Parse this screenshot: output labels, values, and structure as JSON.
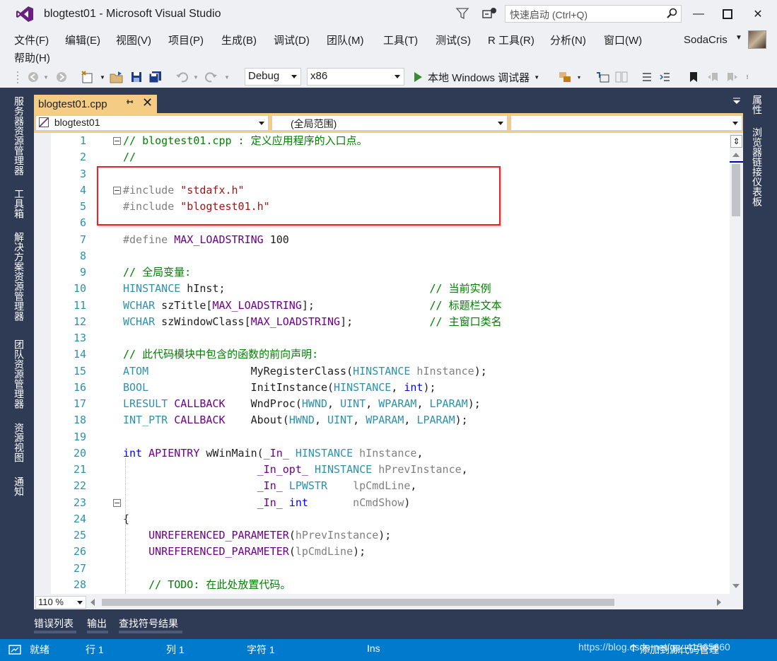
{
  "window": {
    "title": "blogtest01 - Microsoft Visual Studio",
    "quick_launch_placeholder": "快速启动 (Ctrl+Q)",
    "minimize": "—",
    "maximize": "□",
    "close": "✕"
  },
  "menu": {
    "items": [
      "文件(F)",
      "编辑(E)",
      "视图(V)",
      "项目(P)",
      "生成(B)",
      "调试(D)",
      "团队(M)",
      "工具(T)",
      "测试(S)",
      "R 工具(R)",
      "分析(N)",
      "窗口(W)"
    ],
    "help": "帮助(H)",
    "user": "SodaCris"
  },
  "toolbar": {
    "configuration": "Debug",
    "platform": "x86",
    "debugger_label": "本地 Windows 调试器"
  },
  "left_panel_tabs": [
    "服务器资源管理器",
    "工具箱",
    "解决方案资源管理器",
    "团队资源管理器",
    "资源视图",
    "通知"
  ],
  "right_panel_tabs": [
    "属性",
    "浏览器链接仪表板"
  ],
  "document": {
    "tab_label": "blogtest01.cpp",
    "pin_glyph": "⊞",
    "close_glyph": "✕"
  },
  "navbar": {
    "project": "blogtest01",
    "scope": "(全局范围)",
    "member": ""
  },
  "code_lines": [
    {
      "n": "1",
      "html": "<span class=\"c-cm\">// blogtest01.cpp : 定义应用程序的入口点。</span>"
    },
    {
      "n": "2",
      "html": "<span class=\"c-cm\">//</span>"
    },
    {
      "n": "3",
      "html": ""
    },
    {
      "n": "4",
      "html": "<span class=\"c-pp\">#include </span><span class=\"c-str\">\"stdafx.h\"</span>"
    },
    {
      "n": "5",
      "html": "<span class=\"c-pp\">#include </span><span class=\"c-str\">\"blogtest01.h\"</span>"
    },
    {
      "n": "6",
      "html": ""
    },
    {
      "n": "7",
      "html": "<span class=\"c-pp\">#define </span><span class=\"c-mac\">MAX_LOADSTRING</span> 100"
    },
    {
      "n": "8",
      "html": ""
    },
    {
      "n": "9",
      "html": "<span class=\"c-cm\">// 全局变量:</span>"
    },
    {
      "n": "10",
      "html": "<span class=\"c-ty\">HINSTANCE</span> hInst;                                <span class=\"c-cm\">// 当前实例</span>"
    },
    {
      "n": "11",
      "html": "<span class=\"c-ty\">WCHAR</span> szTitle[<span class=\"c-mac\">MAX_LOADSTRING</span>];                  <span class=\"c-cm\">// 标题栏文本</span>"
    },
    {
      "n": "12",
      "html": "<span class=\"c-ty\">WCHAR</span> szWindowClass[<span class=\"c-mac\">MAX_LOADSTRING</span>];            <span class=\"c-cm\">// 主窗口类名</span>"
    },
    {
      "n": "13",
      "html": ""
    },
    {
      "n": "14",
      "html": "<span class=\"c-cm\">// 此代码模块中包含的函数的前向声明:</span>"
    },
    {
      "n": "15",
      "html": "<span class=\"c-ty\">ATOM</span>                MyRegisterClass(<span class=\"c-ty\">HINSTANCE</span> <span class=\"c-par\">hInstance</span>);"
    },
    {
      "n": "16",
      "html": "<span class=\"c-ty\">BOOL</span>                InitInstance(<span class=\"c-ty\">HINSTANCE</span>, <span class=\"c-kw\">int</span>);"
    },
    {
      "n": "17",
      "html": "<span class=\"c-ty\">LRESULT</span> <span class=\"c-mac\">CALLBACK</span>    WndProc(<span class=\"c-ty\">HWND</span>, <span class=\"c-ty\">UINT</span>, <span class=\"c-ty\">WPARAM</span>, <span class=\"c-ty\">LPARAM</span>);"
    },
    {
      "n": "18",
      "html": "<span class=\"c-ty\">INT_PTR</span> <span class=\"c-mac\">CALLBACK</span>    About(<span class=\"c-ty\">HWND</span>, <span class=\"c-ty\">UINT</span>, <span class=\"c-ty\">WPARAM</span>, <span class=\"c-ty\">LPARAM</span>);"
    },
    {
      "n": "19",
      "html": ""
    },
    {
      "n": "20",
      "html": "<span class=\"c-kw\">int</span> <span class=\"c-mac\">APIENTRY</span> wWinMain(<span class=\"c-mac\">_In_</span> <span class=\"c-ty\">HINSTANCE</span> <span class=\"c-par\">hInstance</span>,"
    },
    {
      "n": "21",
      "html": "                     <span class=\"c-mac\">_In_opt_</span> <span class=\"c-ty\">HINSTANCE</span> <span class=\"c-par\">hPrevInstance</span>,"
    },
    {
      "n": "22",
      "html": "                     <span class=\"c-mac\">_In_</span> <span class=\"c-ty\">LPWSTR</span>    <span class=\"c-par\">lpCmdLine</span>,"
    },
    {
      "n": "23",
      "html": "                     <span class=\"c-mac\">_In_</span> <span class=\"c-kw\">int</span>       <span class=\"c-par\">nCmdShow</span>)"
    },
    {
      "n": "24",
      "html": "{"
    },
    {
      "n": "25",
      "html": "    <span class=\"c-mac\">UNREFERENCED_PARAMETER</span>(<span class=\"c-par\">hPrevInstance</span>);"
    },
    {
      "n": "26",
      "html": "    <span class=\"c-mac\">UNREFERENCED_PARAMETER</span>(<span class=\"c-par\">lpCmdLine</span>);"
    },
    {
      "n": "27",
      "html": ""
    },
    {
      "n": "28",
      "html": "    <span class=\"c-cm\">// TODO: 在此处放置代码。</span>"
    }
  ],
  "fold_markers": [
    "1",
    "4",
    "23"
  ],
  "zoom": "110 %",
  "bottom_tabs": [
    "错误列表",
    "输出",
    "查找符号结果"
  ],
  "status": {
    "state": "就绪",
    "line": "行 1",
    "col": "列 1",
    "char": "字符 1",
    "mode": "Ins",
    "source_control": "添加到源代码管理",
    "watermark": "https://blog.csdn.net/qq_41565660"
  },
  "colors": {
    "accent": "#007acc",
    "tab_active": "#f5cc84",
    "panel": "#2f3b55",
    "highlight_box": "#e0282c"
  }
}
